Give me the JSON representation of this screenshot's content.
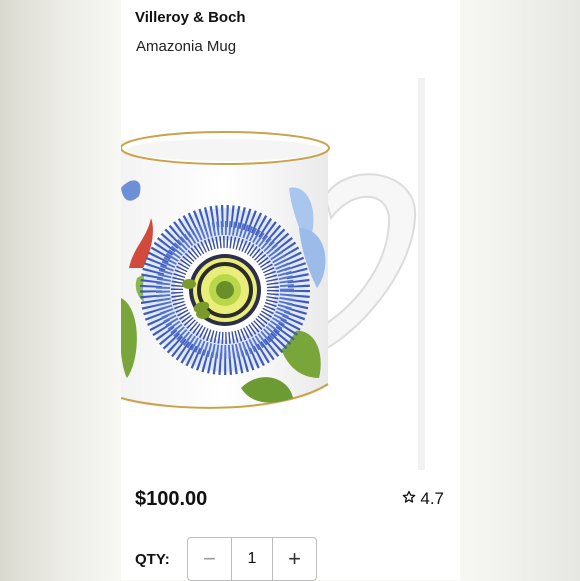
{
  "product": {
    "brand": "Villeroy & Boch",
    "name": "Amazonia Mug",
    "price": "$100.00",
    "rating": "4.7",
    "rating_icon": "star-outline-icon"
  },
  "quantity": {
    "label": "QTY:",
    "value": "1",
    "decrement_symbol": "−",
    "increment_symbol": "+"
  },
  "colors": {
    "flower_blue": "#3f5bb8",
    "leaf_green": "#79a63a",
    "gold_rim": "#c9a24a"
  }
}
